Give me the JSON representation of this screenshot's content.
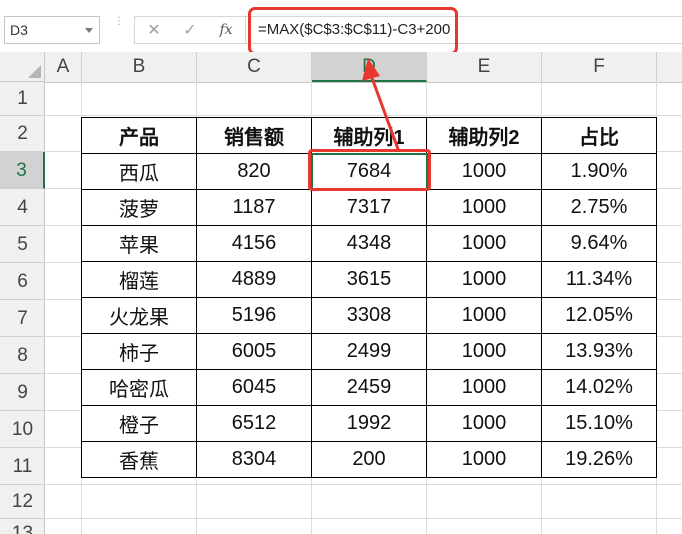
{
  "name_box": {
    "value": "D3"
  },
  "formula_bar": {
    "cancel_icon": "cross-icon",
    "enter_icon": "check-icon",
    "fx_label": "fx",
    "formula": "=MAX($C$3:$C$11)-C3+200"
  },
  "columns": [
    "A",
    "B",
    "C",
    "D",
    "E",
    "F"
  ],
  "active_column": "D",
  "rows": [
    "1",
    "2",
    "3",
    "4",
    "5",
    "6",
    "7",
    "8",
    "9",
    "10",
    "11",
    "12",
    "13"
  ],
  "active_row": "3",
  "table": {
    "headers": [
      "产品",
      "销售额",
      "辅助列1",
      "辅助列2",
      "占比"
    ],
    "rows": [
      [
        "西瓜",
        "820",
        "7684",
        "1000",
        "1.90%"
      ],
      [
        "菠萝",
        "1187",
        "7317",
        "1000",
        "2.75%"
      ],
      [
        "苹果",
        "4156",
        "4348",
        "1000",
        "9.64%"
      ],
      [
        "榴莲",
        "4889",
        "3615",
        "1000",
        "11.34%"
      ],
      [
        "火龙果",
        "5196",
        "3308",
        "1000",
        "12.05%"
      ],
      [
        "柿子",
        "6005",
        "2499",
        "1000",
        "13.93%"
      ],
      [
        "哈密瓜",
        "6045",
        "2459",
        "1000",
        "14.02%"
      ],
      [
        "橙子",
        "6512",
        "1992",
        "1000",
        "15.10%"
      ],
      [
        "香蕉",
        "8304",
        "200",
        "1000",
        "19.26%"
      ]
    ]
  },
  "colors": {
    "highlight": "#e8372f",
    "excel_green": "#217346"
  }
}
